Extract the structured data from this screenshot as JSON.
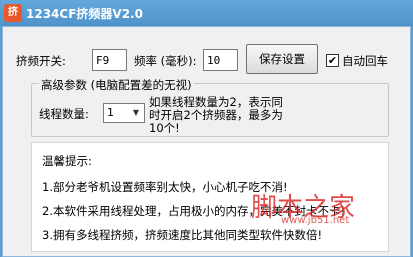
{
  "window": {
    "title": "1234CF挤频器V2.0",
    "icon_text": "挤"
  },
  "settings": {
    "switch_label": "挤频开关:",
    "switch_value": "F9",
    "frequency_label": "频率 (毫秒):",
    "frequency_value": "10",
    "save_button": "保存设置",
    "auto_enter_label": "自动回车",
    "auto_enter_checked": true
  },
  "advanced": {
    "group_label": "高级参数 (电脑配置差的无视)",
    "threads_label": "线程数量:",
    "threads_value": "1",
    "threads_note": "如果线程数量为2，表示同时开启2个挤频器，最多为10个!"
  },
  "tips": {
    "title": "温馨提示:",
    "items": [
      "1.部分老爷机设置频率别太快，小心机子吃不消!",
      "2.本软件采用线程处理，占用极小的内存，完美不封卡不卡!",
      "3.拥有多线程挤频，挤频速度比其他同类型软件快数倍!"
    ]
  },
  "watermark": {
    "text": "脚本之家",
    "url": "www.jb51.net"
  }
}
